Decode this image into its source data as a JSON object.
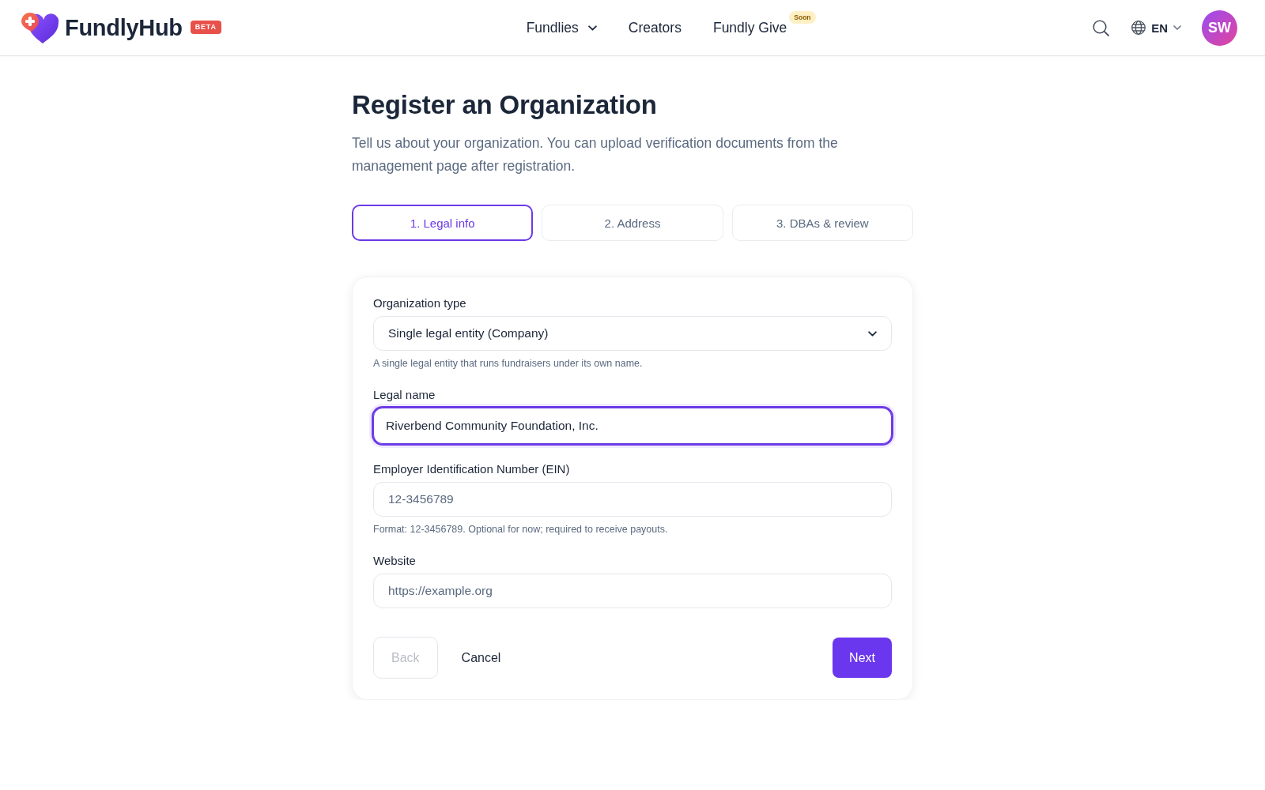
{
  "header": {
    "brand": "FundlyHub",
    "brand_badge": "BETA",
    "nav": [
      {
        "label": "Fundlies",
        "kind": "dropdown"
      },
      {
        "label": "Creators",
        "kind": "link"
      },
      {
        "label": "Fundly Give",
        "kind": "link",
        "badge": "Soon"
      }
    ],
    "language": "EN",
    "avatar": "SW"
  },
  "page": {
    "title": "Register an Organization",
    "description": "Tell us about your organization. You can upload verification documents from the management page after registration."
  },
  "steps": [
    {
      "label": "1. Legal info",
      "selected": true
    },
    {
      "label": "2. Address",
      "selected": false
    },
    {
      "label": "3. DBAs & review",
      "selected": false
    }
  ],
  "form": {
    "fields": [
      {
        "kind": "select",
        "label": "Organization type",
        "value": "Single legal entity (Company)",
        "help": "A single legal entity that runs fundraisers under its own name.",
        "focused": false
      },
      {
        "kind": "text",
        "label": "Legal name",
        "value": "Riverbend Community Foundation, Inc.",
        "focused": true
      },
      {
        "kind": "text",
        "label": "Employer Identification Number (EIN)",
        "placeholder": "12-3456789",
        "help": "Format: 12-3456789. Optional for now; required to receive payouts.",
        "focused": false
      },
      {
        "kind": "text",
        "label": "Website",
        "placeholder": "https://example.org",
        "focused": false
      }
    ],
    "buttons": [
      {
        "label": "Back",
        "kind": "secondary",
        "disabled": true
      },
      {
        "label": "Cancel",
        "kind": "link",
        "disabled": false
      },
      {
        "label": "Next",
        "kind": "primary",
        "disabled": false
      }
    ]
  }
}
